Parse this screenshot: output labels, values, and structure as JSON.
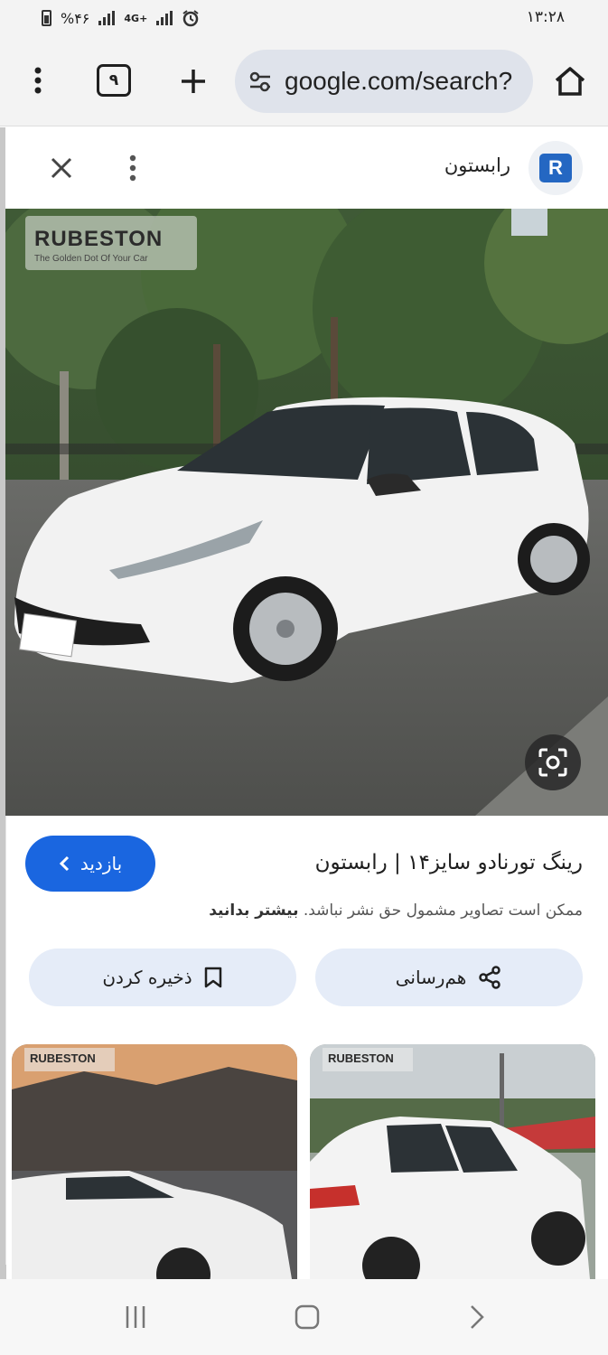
{
  "status_bar": {
    "time": "۱۳:۲۸",
    "battery": "%۴۶",
    "network": "4G+"
  },
  "browser": {
    "tab_count": "۹",
    "url": "google.com/search?",
    "icons": [
      "more-vert-icon",
      "tabs-icon",
      "plus-icon",
      "tune-icon",
      "home-icon"
    ]
  },
  "sheet": {
    "site_name": "رابستون",
    "site_logo_letter": "R"
  },
  "image": {
    "watermark_title": "RUBESTON",
    "watermark_subtitle": "The Golden Dot Of Your Car"
  },
  "result": {
    "title": "رینگ تورنادو سایز۱۴ | رابستون",
    "visit_label": "بازدید",
    "copyright_text": "ممکن است تصاویر مشمول حق نشر نباشد.",
    "learn_more": "بیشتر بدانید"
  },
  "actions": {
    "share_label": "هم‌رسانی",
    "save_label": "ذخیره کردن"
  },
  "related": {
    "left_watermark": "RUBESTON",
    "right_watermark": "RUBESTON"
  },
  "colors": {
    "accent": "#1a66e0",
    "chip_bg": "#e5ecf8",
    "omnibox_bg": "#dfe3eb"
  }
}
